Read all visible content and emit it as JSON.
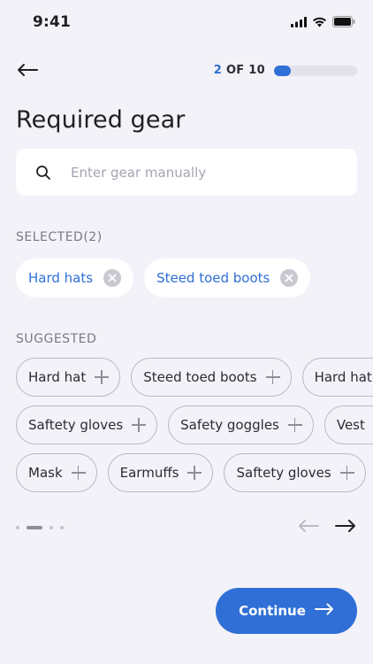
{
  "status_bar": {
    "time": "9:41"
  },
  "nav": {
    "step_current": "2",
    "step_rest": " OF 10",
    "progress": 0.2
  },
  "title": "Required gear",
  "search": {
    "placeholder": "Enter gear manually",
    "value": ""
  },
  "selected": {
    "label": "SELECTED(2)",
    "items": [
      {
        "label": "Hard hats"
      },
      {
        "label": "Steed toed boots"
      }
    ]
  },
  "suggested": {
    "label": "SUGGESTED",
    "rows": [
      [
        {
          "label": "Hard hat"
        },
        {
          "label": "Steed toed boots"
        },
        {
          "label": "Hard hat"
        }
      ],
      [
        {
          "label": "Saftety gloves"
        },
        {
          "label": "Safety goggles"
        },
        {
          "label": "Vest"
        }
      ],
      [
        {
          "label": "Mask"
        },
        {
          "label": "Earmuffs"
        },
        {
          "label": "Saftety gloves"
        }
      ]
    ]
  },
  "pagination": {
    "pages": 4,
    "active": 1
  },
  "continue_label": "Continue",
  "colors": {
    "accent": "#2f6fd6",
    "background": "#f3f2f8"
  }
}
